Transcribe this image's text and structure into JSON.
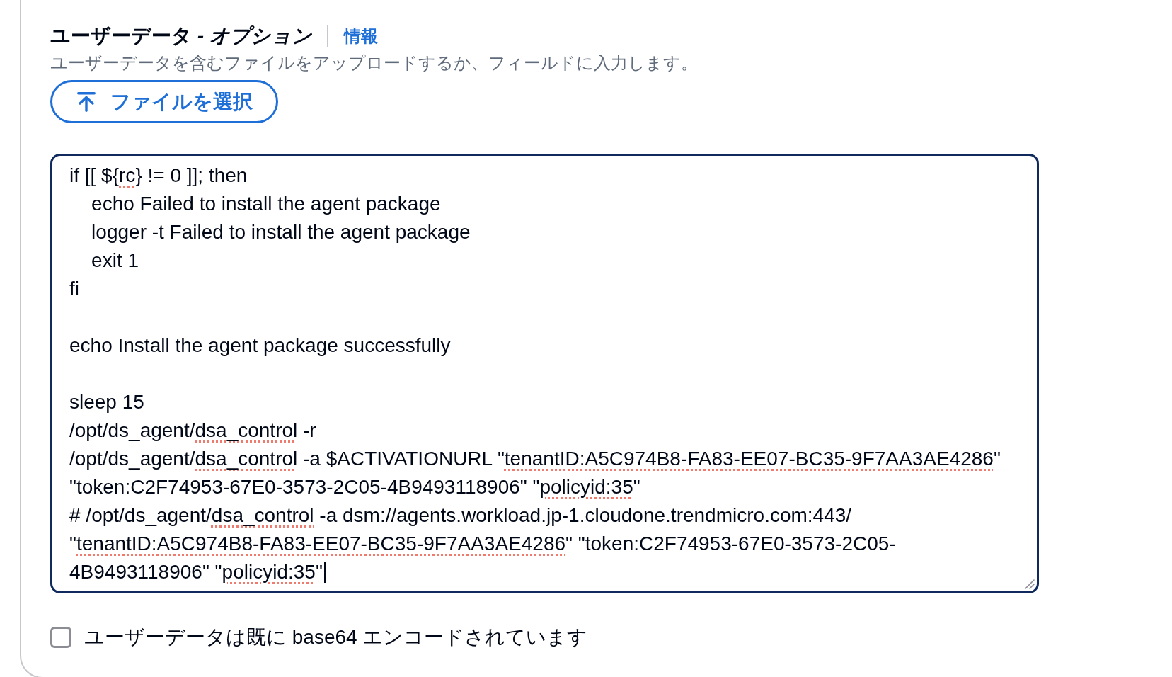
{
  "section": {
    "title": "ユーザーデータ *- オプション*",
    "info_link": "情報",
    "description": "ユーザーデータを含むファイルをアップロードするか、フィールドに入力します。"
  },
  "file_button": {
    "label": "ファイルを選択"
  },
  "user_data_field": {
    "focused": true,
    "blocks": [
      {
        "lines": [
          {
            "segments": [
              {
                "text": "if [[ ${",
                "spellcheck_error": false
              },
              {
                "text": "rc",
                "spellcheck_error": true
              },
              {
                "text": "} != 0 ]]; then",
                "spellcheck_error": false
              }
            ]
          },
          {
            "segments": [
              {
                "text": "    echo Failed to install the agent package",
                "spellcheck_error": false
              }
            ]
          },
          {
            "segments": [
              {
                "text": "    logger -t Failed to install the agent package",
                "spellcheck_error": false
              }
            ]
          },
          {
            "segments": [
              {
                "text": "    exit 1",
                "spellcheck_error": false
              }
            ]
          },
          {
            "segments": [
              {
                "text": "fi",
                "spellcheck_error": false
              }
            ]
          }
        ]
      },
      {
        "lines": [
          {
            "segments": [
              {
                "text": "echo Install the agent package successfully",
                "spellcheck_error": false
              }
            ]
          }
        ]
      },
      {
        "lines": [
          {
            "segments": [
              {
                "text": "sleep 15",
                "spellcheck_error": false
              }
            ]
          },
          {
            "segments": [
              {
                "text": "/opt/ds_agent/",
                "spellcheck_error": false
              },
              {
                "text": "dsa_control",
                "spellcheck_error": true
              },
              {
                "text": " -r",
                "spellcheck_error": false
              }
            ]
          },
          {
            "segments": [
              {
                "text": "/opt/ds_agent/",
                "spellcheck_error": false
              },
              {
                "text": "dsa_control",
                "spellcheck_error": true
              },
              {
                "text": " -a $ACTIVATIONURL \"",
                "spellcheck_error": false
              },
              {
                "text": "tenantID:A5C974B8-FA83-EE07-BC35-9F7AA3AE4286",
                "spellcheck_error": true
              },
              {
                "text": "\"",
                "spellcheck_error": false
              }
            ]
          },
          {
            "segments": [
              {
                "text": "\"token:C2F74953-67E0-3573-2C05-4B9493118906\" \"",
                "spellcheck_error": false
              },
              {
                "text": "policyid:35",
                "spellcheck_error": true
              },
              {
                "text": "\"",
                "spellcheck_error": false
              }
            ]
          },
          {
            "segments": [
              {
                "text": "# /opt/ds_agent/",
                "spellcheck_error": false
              },
              {
                "text": "dsa_control",
                "spellcheck_error": true
              },
              {
                "text": " -a dsm://agents.workload.jp-1.cloudone.trendmicro.com:443/",
                "spellcheck_error": false
              }
            ]
          },
          {
            "segments": [
              {
                "text": "\"",
                "spellcheck_error": false
              },
              {
                "text": "tenantID:A5C974B8-FA83-EE07-BC35-9F7AA3AE4286",
                "spellcheck_error": true
              },
              {
                "text": "\" \"token:C2F74953-67E0-3573-2C05-",
                "spellcheck_error": false
              }
            ]
          },
          {
            "segments": [
              {
                "text": "4B9493118906\" \"",
                "spellcheck_error": false
              },
              {
                "text": "policyid:35",
                "spellcheck_error": true
              },
              {
                "text": "\"",
                "spellcheck_error": false
              }
            ]
          }
        ]
      }
    ]
  },
  "base64_checkbox": {
    "label": "ユーザーデータは既に base64 エンコードされています",
    "checked": false
  }
}
